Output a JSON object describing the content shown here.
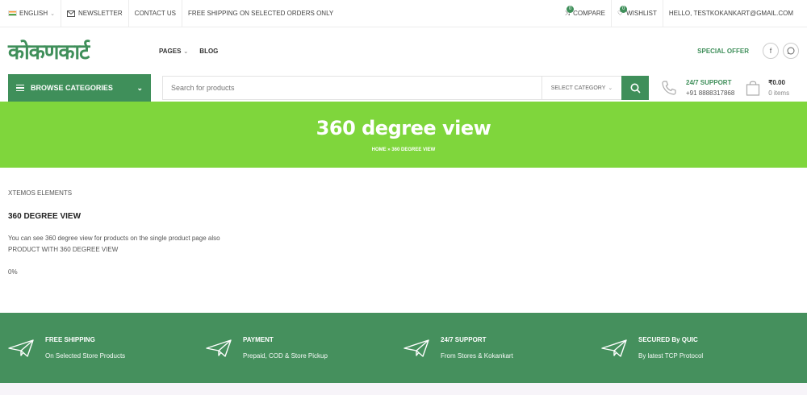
{
  "topbar": {
    "language": "ENGLISH",
    "newsletter": "NEWSLETTER",
    "contact": "CONTACT US",
    "shipping_note": "FREE SHIPPING ON SELECTED ORDERS ONLY",
    "compare": "COMPARE",
    "compare_count": "0",
    "wishlist": "WISHLIST",
    "wishlist_count": "0",
    "greeting": "HELLO, TESTKOKANKART@GMAIL.COM"
  },
  "header": {
    "logo_text": "कोकणकार्ट",
    "nav": [
      "PAGES",
      "BLOG"
    ],
    "special_offer": "SPECIAL OFFER",
    "social": [
      "f",
      "w"
    ]
  },
  "categories": {
    "label": "BROWSE CATEGORIES"
  },
  "search": {
    "placeholder": "Search for products",
    "category_select": "SELECT CATEGORY"
  },
  "support": {
    "title": "24/7 SUPPORT",
    "phone": "+91 8888317868"
  },
  "cart": {
    "amount": "₹0.00",
    "items": "0 items"
  },
  "hero": {
    "title": "360 degree view",
    "breadcrumb": "HOME » 360 DEGREE VIEW"
  },
  "content": {
    "eyebrow": "XTEMOS ELEMENTS",
    "heading": "360 DEGREE VIEW",
    "line1": "You can see 360 degree view for products on the single product page also",
    "line2": "PRODUCT WITH 360 DEGREE VIEW",
    "progress": "0%"
  },
  "features": [
    {
      "title": "FREE SHIPPING",
      "subtitle": "On Selected Store Products"
    },
    {
      "title": "PAYMENT",
      "subtitle": "Prepaid, COD & Store Pickup"
    },
    {
      "title": "24/7 SUPPORT",
      "subtitle": "From Stores & Kokankart"
    },
    {
      "title": "SECURED By QUIC",
      "subtitle": "By latest TCP Protocol"
    }
  ],
  "colors": {
    "brand_green": "#3f8f5a",
    "hero_green": "#7fd63c",
    "footer_green": "#45905d"
  },
  "icons": [
    "flag-india-icon",
    "mail-icon",
    "compare-icon",
    "heart-icon",
    "menu-icon",
    "search-icon",
    "phone-icon",
    "bag-icon",
    "paper-plane-icon"
  ]
}
